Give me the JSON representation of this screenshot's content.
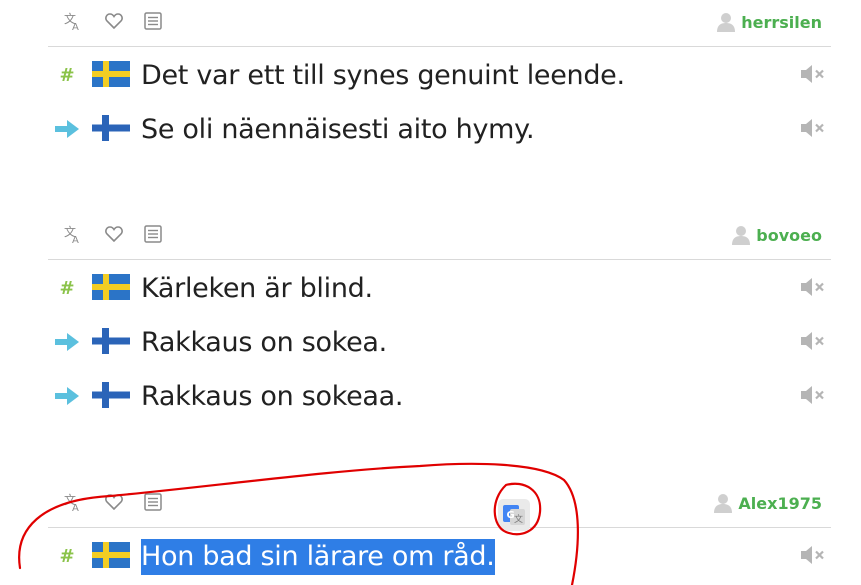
{
  "icons": {
    "translate": "translate-icon",
    "favorite": "heart-icon",
    "list": "list-icon",
    "user": "user-icon",
    "mute": "speaker-muted-icon",
    "original": "hash-icon",
    "translation": "arrow-right-icon"
  },
  "colors": {
    "username": "#4caf50",
    "hash": "#8bc34a",
    "arrow": "#5bc0de",
    "selection": "#2f7ee6",
    "annotation": "#e00000"
  },
  "cards": [
    {
      "username": "herrsilen",
      "sentences": [
        {
          "lang": "swe",
          "type": "original",
          "text": "Det var ett till synes genuint leende."
        },
        {
          "lang": "fin",
          "type": "translation",
          "text": "Se oli näennäisesti aito hymy."
        }
      ]
    },
    {
      "username": "bovoeo",
      "sentences": [
        {
          "lang": "swe",
          "type": "original",
          "text": "Kärleken är blind."
        },
        {
          "lang": "fin",
          "type": "translation",
          "text": "Rakkaus on sokea."
        },
        {
          "lang": "fin",
          "type": "translation",
          "text": "Rakkaus on sokeaa."
        }
      ]
    },
    {
      "username": "Alex1975",
      "sentences": [
        {
          "lang": "swe",
          "type": "original",
          "text": "Hon bad sin lärare om råd.",
          "selected": true
        }
      ]
    }
  ]
}
